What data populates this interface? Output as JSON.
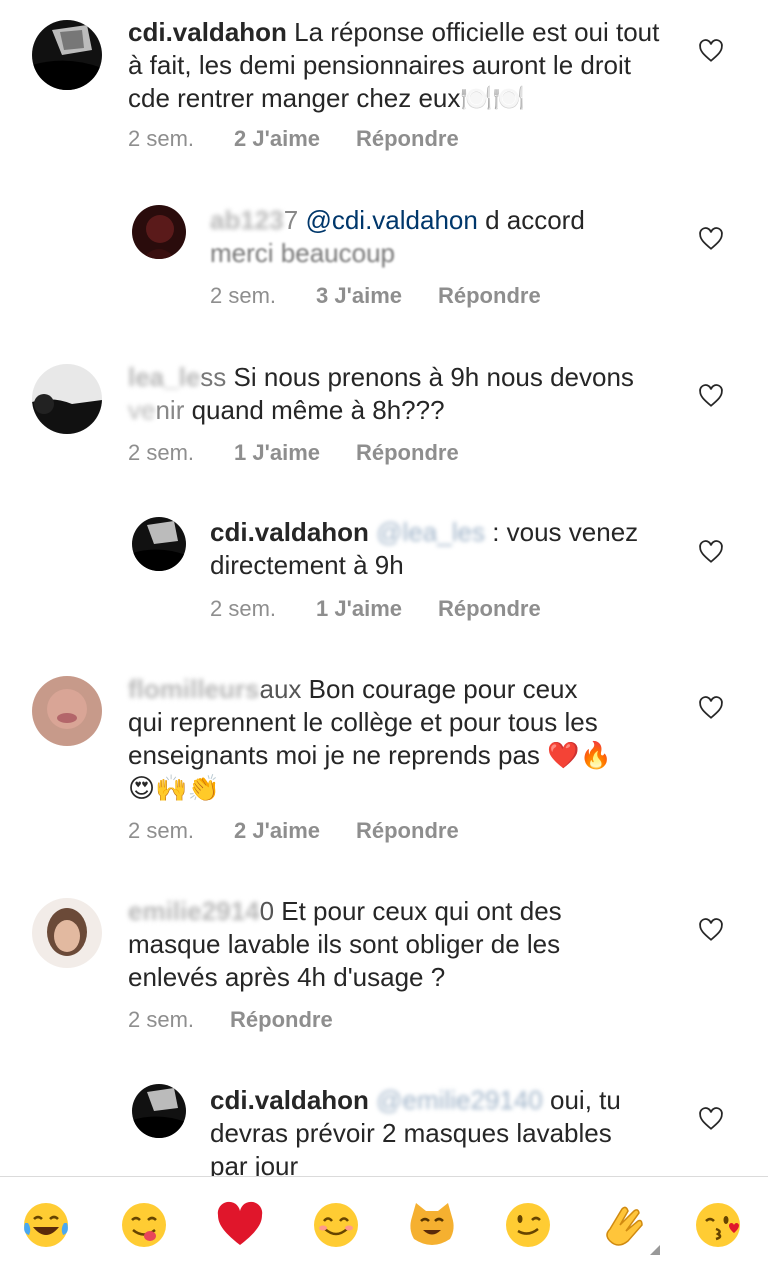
{
  "comments": [
    {
      "user": "cdi.valdahon",
      "text": "La réponse officielle est oui tout à fait, les demi pensionnaires auront le droit cde rentrer manger chez eux🍽️🍽️",
      "time": "2 sem.",
      "likes": "2 J'aime",
      "reply": "Répondre"
    },
    {
      "user_tail": "7",
      "mention": "@cdi.valdahon",
      "text_line1": "d accord",
      "text_line2": "merci beaucoup",
      "time": "2 sem.",
      "likes": "3 J'aime",
      "reply": "Répondre"
    },
    {
      "user_tail": "ss",
      "text_line1": "Si nous prenons à 9h nous devons",
      "text_line2": "quand même à 8h???",
      "time": "2 sem.",
      "likes": "1 J'aime",
      "reply": "Répondre"
    },
    {
      "user": "cdi.valdahon",
      "text_after": ": vous venez",
      "text_line2": "directement à 9h",
      "time": "2 sem.",
      "likes": "1 J'aime",
      "reply": "Répondre"
    },
    {
      "user_tail": "aux",
      "text_line1": "Bon courage pour ceux",
      "text_line2": "qui reprennent le collège et pour tous les",
      "text_line3": "enseignants moi je ne reprends pas ❤️🔥",
      "text_line4": "😍🙌👏",
      "time": "2 sem.",
      "likes": "2 J'aime",
      "reply": "Répondre"
    },
    {
      "user_tail": "0",
      "text_line1": "Et pour ceux qui ont des",
      "text_line2": "masque lavable ils sont obliger de les",
      "text_line3": "enlevés après 4h d'usage ?",
      "time": "2 sem.",
      "reply": "Répondre"
    },
    {
      "user": "cdi.valdahon",
      "text_after": "oui, tu",
      "text_line2": "devras prévoir 2 masques lavables",
      "text_line3": "par jour"
    }
  ],
  "emoji_bar": [
    "😂",
    "😋",
    "❤️",
    "😊",
    "😸",
    "😉",
    "👏",
    "😘"
  ],
  "colors": {
    "text": "#262626",
    "meta": "#8e8e8e",
    "mention": "#00376b",
    "heart": "#262626"
  }
}
